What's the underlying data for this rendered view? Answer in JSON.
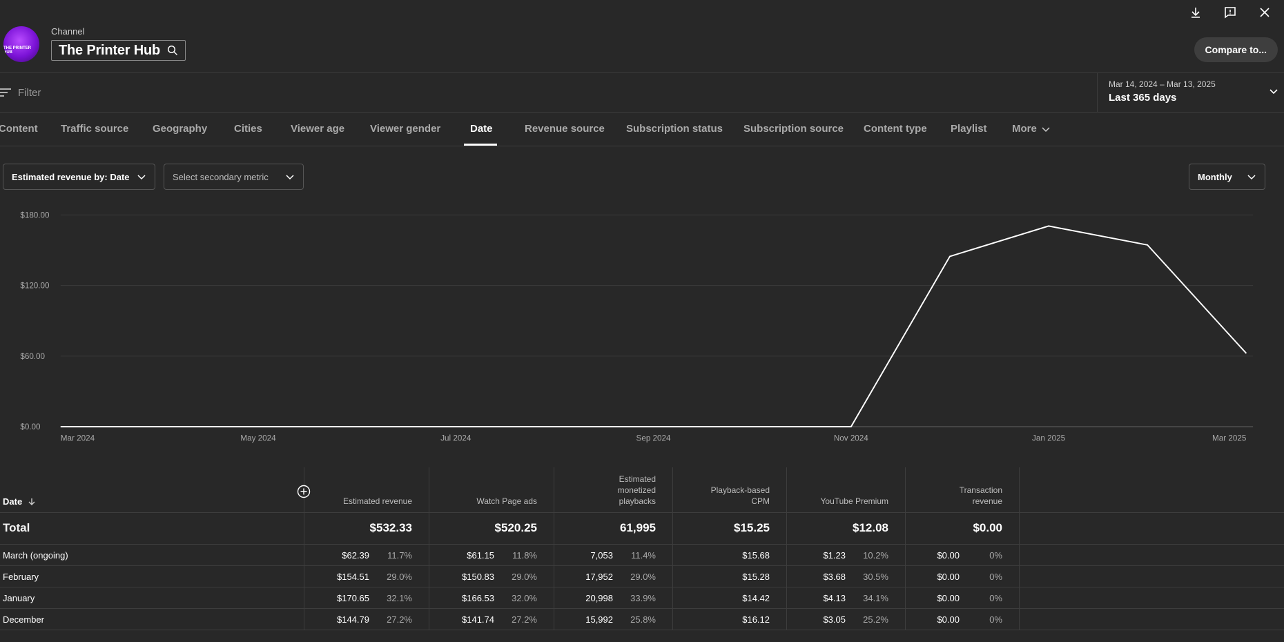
{
  "header": {
    "kicker": "Channel",
    "channel_name": "The Printer Hub",
    "avatar_text": "THE PRINTER HUB",
    "compare_label": "Compare to..."
  },
  "filter": {
    "placeholder": "Filter"
  },
  "date_range": {
    "range": "Mar 14, 2024 – Mar 13, 2025",
    "label": "Last 365 days"
  },
  "tabs": [
    {
      "label": "Content"
    },
    {
      "label": "Traffic source"
    },
    {
      "label": "Geography"
    },
    {
      "label": "Cities"
    },
    {
      "label": "Viewer age"
    },
    {
      "label": "Viewer gender"
    },
    {
      "label": "Date",
      "active": true
    },
    {
      "label": "Revenue source"
    },
    {
      "label": "Subscription status"
    },
    {
      "label": "Subscription source"
    },
    {
      "label": "Content type"
    },
    {
      "label": "Playlist"
    },
    {
      "label": "More"
    }
  ],
  "controls": {
    "primary_metric": "Estimated revenue by: Date",
    "secondary_metric": "Select secondary metric",
    "interval": "Monthly"
  },
  "chart_data": {
    "type": "line",
    "x": [
      "2024-03",
      "2024-04",
      "2024-05",
      "2024-06",
      "2024-07",
      "2024-08",
      "2024-09",
      "2024-10",
      "2024-11",
      "2024-12",
      "2025-01",
      "2025-02",
      "2025-03"
    ],
    "series": [
      {
        "values": [
          0,
          0,
          0,
          0,
          0,
          0,
          0,
          0,
          0,
          144.79,
          170.65,
          154.51,
          62.39
        ]
      }
    ],
    "xticks": [
      "Mar 2024",
      "May 2024",
      "Jul 2024",
      "Sep 2024",
      "Nov 2024",
      "Jan 2025",
      "Mar 2025"
    ],
    "yticks": [
      "$0.00",
      "$60.00",
      "$120.00",
      "$180.00"
    ],
    "ylim": [
      0,
      180
    ],
    "grid": true
  },
  "table": {
    "date_header": "Date",
    "columns": [
      {
        "label": "Estimated revenue"
      },
      {
        "label": "Watch Page ads"
      },
      {
        "label": "Estimated monetized playbacks"
      },
      {
        "label": "Playback-based CPM"
      },
      {
        "label": "YouTube Premium"
      },
      {
        "label": "Transaction revenue"
      }
    ],
    "total": {
      "label": "Total",
      "values": [
        "$532.33",
        "$520.25",
        "61,995",
        "$15.25",
        "$12.08",
        "$0.00"
      ]
    },
    "rows": [
      {
        "label": "March (ongoing)",
        "cells": [
          [
            "$62.39",
            "11.7%"
          ],
          [
            "$61.15",
            "11.8%"
          ],
          [
            "7,053",
            "11.4%"
          ],
          [
            "$15.68",
            ""
          ],
          [
            "$1.23",
            "10.2%"
          ],
          [
            "$0.00",
            "0%"
          ]
        ]
      },
      {
        "label": "February",
        "cells": [
          [
            "$154.51",
            "29.0%"
          ],
          [
            "$150.83",
            "29.0%"
          ],
          [
            "17,952",
            "29.0%"
          ],
          [
            "$15.28",
            ""
          ],
          [
            "$3.68",
            "30.5%"
          ],
          [
            "$0.00",
            "0%"
          ]
        ]
      },
      {
        "label": "January",
        "cells": [
          [
            "$170.65",
            "32.1%"
          ],
          [
            "$166.53",
            "32.0%"
          ],
          [
            "20,998",
            "33.9%"
          ],
          [
            "$14.42",
            ""
          ],
          [
            "$4.13",
            "34.1%"
          ],
          [
            "$0.00",
            "0%"
          ]
        ]
      },
      {
        "label": "December",
        "cells": [
          [
            "$144.79",
            "27.2%"
          ],
          [
            "$141.74",
            "27.2%"
          ],
          [
            "15,992",
            "25.8%"
          ],
          [
            "$16.12",
            ""
          ],
          [
            "$3.05",
            "25.2%"
          ],
          [
            "$0.00",
            "0%"
          ]
        ]
      }
    ]
  }
}
